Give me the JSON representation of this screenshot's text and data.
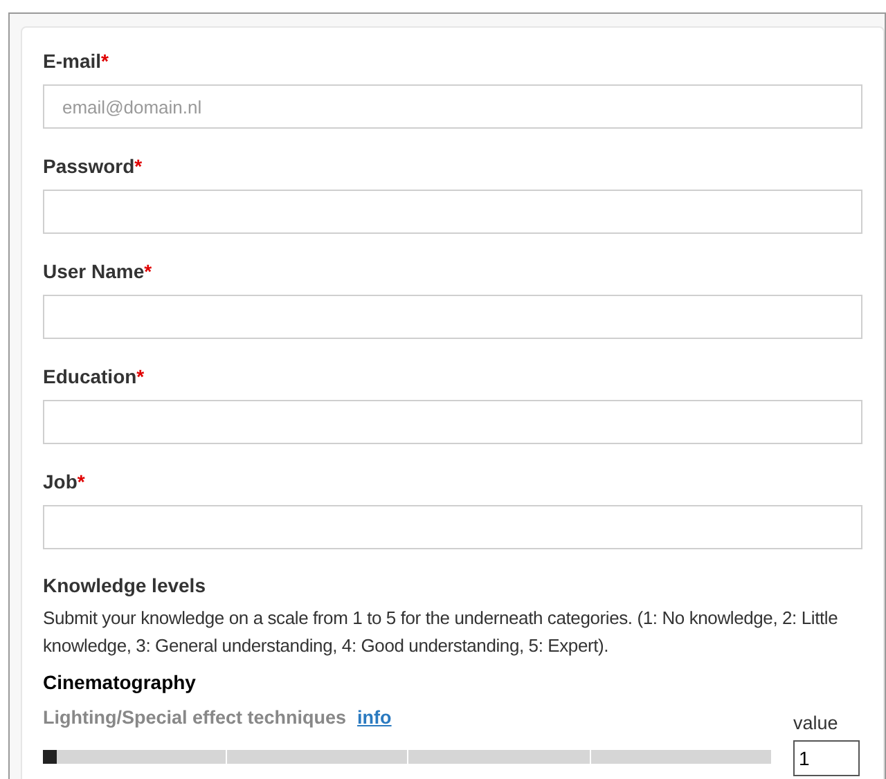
{
  "fields": [
    {
      "label": "E-mail",
      "required_mark": "*",
      "placeholder": "email@domain.nl"
    },
    {
      "label": "Password",
      "required_mark": "*"
    },
    {
      "label": "User Name",
      "required_mark": "*"
    },
    {
      "label": "Education",
      "required_mark": "*"
    },
    {
      "label": "Job",
      "required_mark": "*"
    }
  ],
  "knowledge": {
    "title": "Knowledge levels",
    "description": "Submit your knowledge on a scale from 1 to 5 for the underneath categories. (1: No knowledge, 2: Little knowledge, 3: General understanding, 4: Good understanding, 5: Expert).",
    "category": "Cinematography",
    "items": [
      {
        "label": "Lighting/Special effect techniques",
        "link": "info",
        "value_label": "value",
        "value": "1",
        "level": 0
      }
    ]
  }
}
